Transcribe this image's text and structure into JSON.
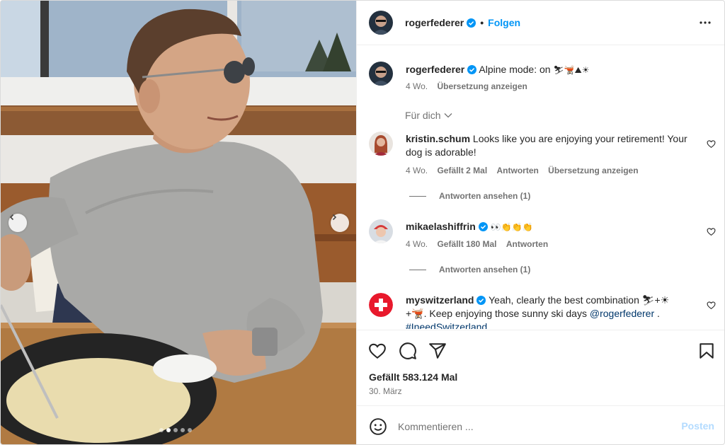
{
  "post": {
    "author": "rogerfederer",
    "follow_sep": "•",
    "follow_label": "Folgen",
    "caption": "Alpine mode: on",
    "caption_emoji": "⛷🫕⛰☀",
    "caption_age": "4 Wo.",
    "caption_translate": "Übersetzung anzeigen",
    "for_you": "Für dich"
  },
  "comments": [
    {
      "user": "kristin.schum",
      "text": "Looks like you are enjoying your retirement! Your dog is adorable!",
      "age": "4 Wo.",
      "likes": "Gefällt 2 Mal",
      "reply": "Antworten",
      "translate": "Übersetzung anzeigen",
      "view_replies": "Antworten ansehen (1)"
    },
    {
      "user": "mikaelashiffrin",
      "text": "👀👏👏👏",
      "age": "4 Wo.",
      "likes": "Gefällt 180 Mal",
      "reply": "Antworten",
      "view_replies": "Antworten ansehen (1)"
    },
    {
      "user": "myswitzerland",
      "text_a": "Yeah, clearly the best combination ⛷+☀",
      "text_b": "+🫕. Keep enjoying those sunny ski days",
      "mention": "@rogerfederer",
      "text_end": ".",
      "hashtag": "#IneedSwitzerland"
    }
  ],
  "actions": {
    "likes_label": "Gefällt 583.124 Mal",
    "date": "30. März"
  },
  "composer": {
    "placeholder": "Kommentieren ...",
    "post_label": "Posten"
  },
  "icons": {
    "verified": "verified-badge-icon",
    "more": "more-options-icon",
    "heart": "heart-icon",
    "comment": "comment-bubble-icon",
    "share": "paper-plane-icon",
    "save": "bookmark-icon",
    "emoji": "smiley-icon",
    "chevron": "chevron-down-icon"
  },
  "colors": {
    "link_blue": "#0095f6",
    "verified_blue": "#0095f6",
    "muted_text": "#737373",
    "post_disabled": "#b3dbff"
  },
  "carousel": {
    "slides": 5,
    "active": 2
  }
}
